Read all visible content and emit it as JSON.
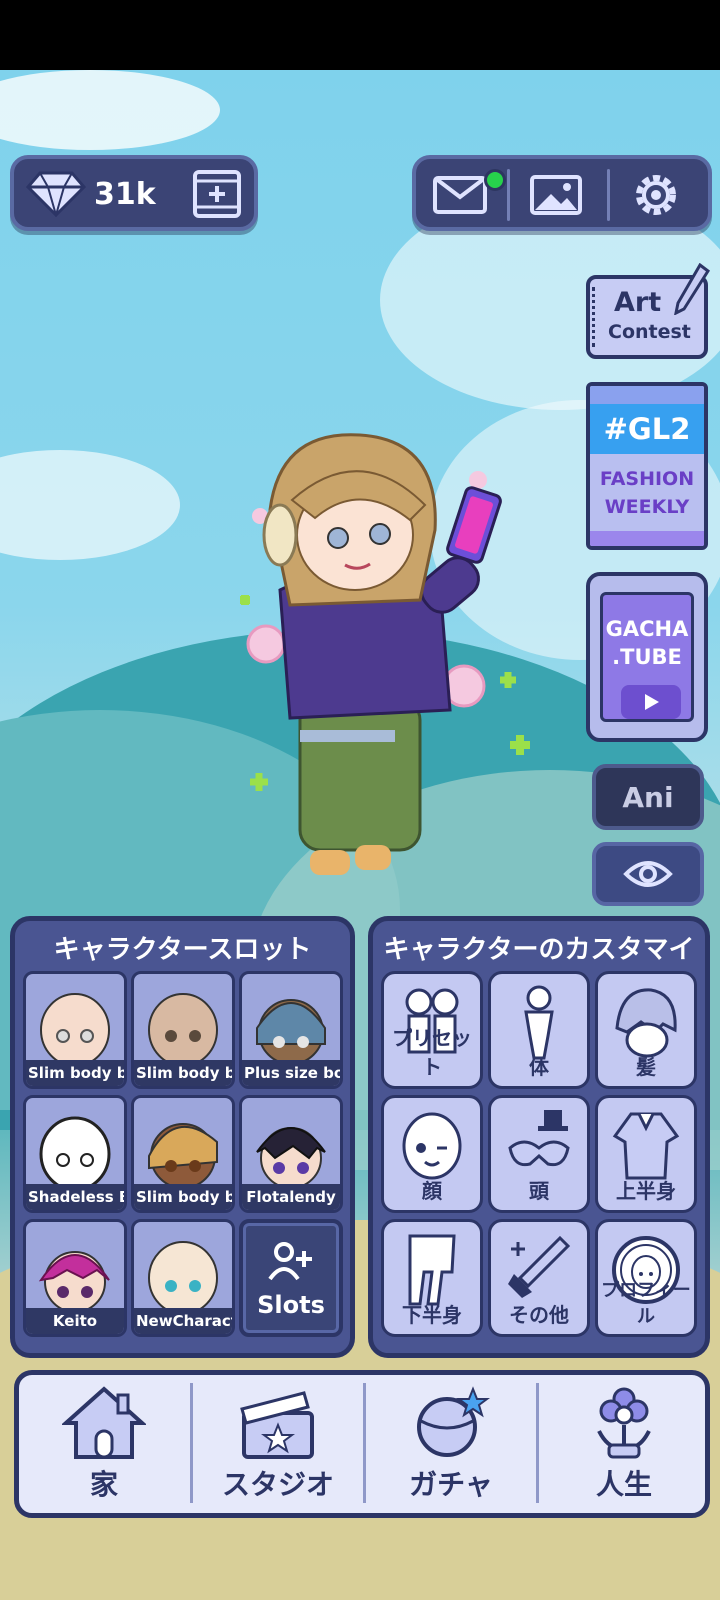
{
  "currency": {
    "amount": "31k"
  },
  "side": {
    "art_contest": [
      "Art",
      "Contest"
    ],
    "gl2": {
      "tag": "#GL2",
      "line1": "FASHION",
      "line2": "WEEKLY"
    },
    "gacha_tube": [
      "GACHA",
      ".TUBE"
    ],
    "ani": "Ani"
  },
  "slots_panel": {
    "title": "キャラクタースロット",
    "slots": [
      {
        "label": "Slim body bas"
      },
      {
        "label": "Slim body bas"
      },
      {
        "label": "Plus size body"
      },
      {
        "label": "Shadeless Bas"
      },
      {
        "label": "Slim body bas"
      },
      {
        "label": "Flotalendy"
      },
      {
        "label": "Keito"
      },
      {
        "label": "NewCharacter"
      }
    ],
    "add_label": "Slots"
  },
  "custom_panel": {
    "title": "キャラクターのカスタマイズ",
    "items": [
      {
        "label": "プリセット",
        "icon": "preset-icon"
      },
      {
        "label": "体",
        "icon": "body-icon"
      },
      {
        "label": "髪",
        "icon": "hair-icon"
      },
      {
        "label": "顔",
        "icon": "face-icon"
      },
      {
        "label": "頭",
        "icon": "head-icon"
      },
      {
        "label": "上半身",
        "icon": "upper-body-icon"
      },
      {
        "label": "下半身",
        "icon": "lower-body-icon"
      },
      {
        "label": "その他",
        "icon": "other-icon"
      },
      {
        "label": "プロフィール",
        "icon": "profile-icon"
      }
    ]
  },
  "bottom_nav": [
    {
      "label": "家",
      "icon": "home-icon"
    },
    {
      "label": "スタジオ",
      "icon": "studio-icon"
    },
    {
      "label": "ガチャ",
      "icon": "gacha-icon"
    },
    {
      "label": "人生",
      "icon": "life-icon"
    }
  ],
  "colors": {
    "panel": "#4a5592",
    "border": "#2c3566",
    "card": "#c4c9f2",
    "accent_green": "#27d14c"
  }
}
